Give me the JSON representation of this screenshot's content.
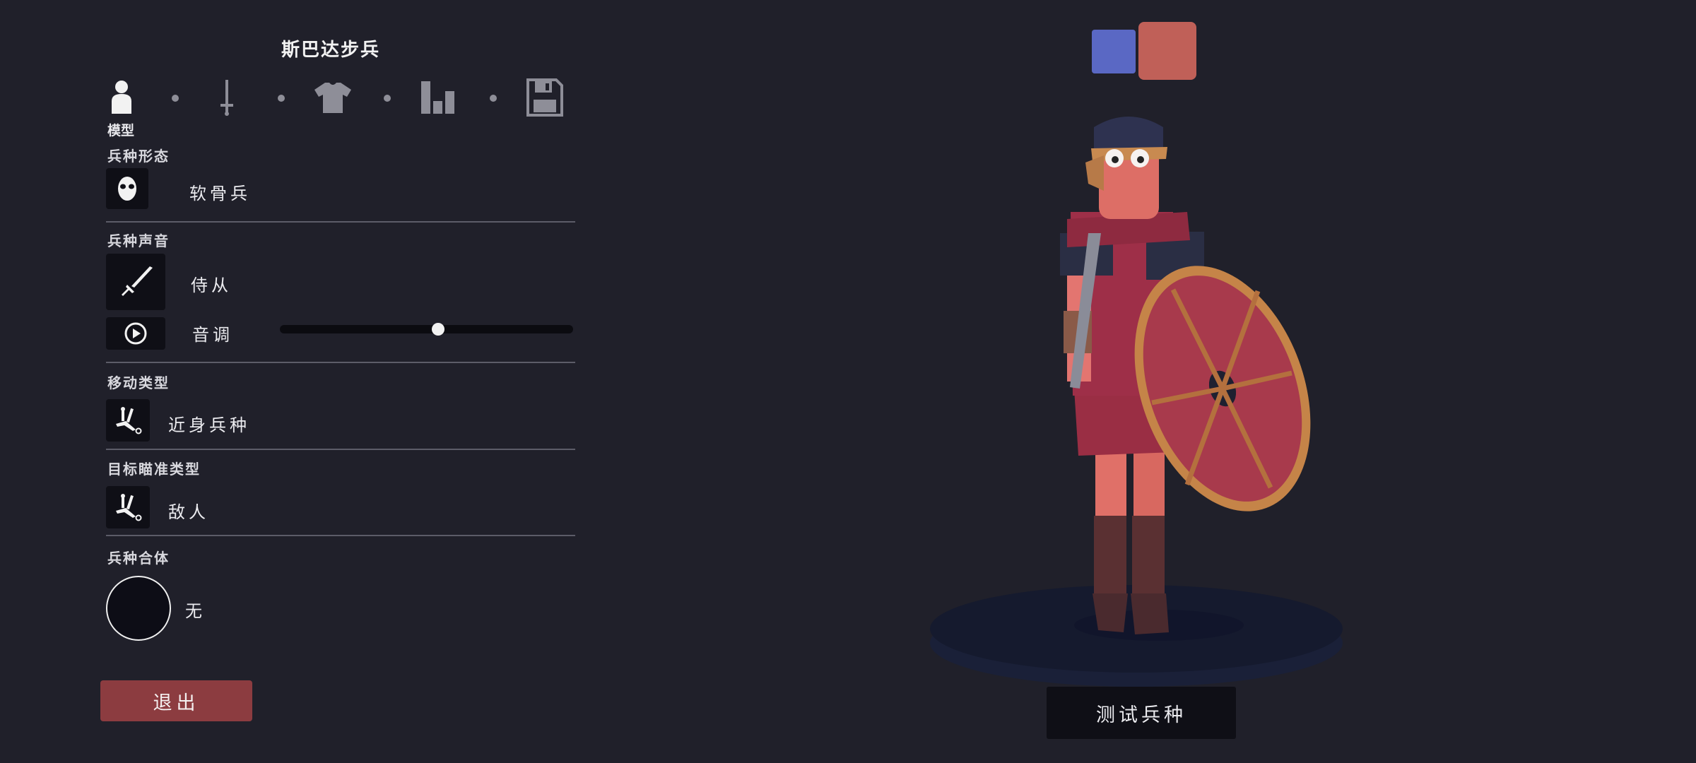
{
  "unit_name": "斯巴达步兵",
  "tabs": [
    {
      "label": "模型",
      "icon": "person-icon",
      "active": true
    },
    {
      "icon": "sword-icon"
    },
    {
      "icon": "shirt-icon"
    },
    {
      "icon": "bar-chart-icon"
    },
    {
      "icon": "save-icon"
    }
  ],
  "sections": {
    "form": {
      "label": "兵种形态",
      "value": "软骨兵",
      "icon": "mask-icon"
    },
    "voice": {
      "label": "兵种声音",
      "value": "侍从",
      "icon": "sword-icon",
      "pitch_label": "音调",
      "pitch_value": 0.54,
      "play_icon": "play-icon"
    },
    "movement": {
      "label": "移动类型",
      "value": "近身兵种",
      "icon": "melee-icon"
    },
    "targeting": {
      "label": "目标瞄准类型",
      "value": "敌人",
      "icon": "melee-icon"
    },
    "combine": {
      "label": "兵种合体",
      "value": "无"
    }
  },
  "buttons": {
    "exit": "退出",
    "test": "测试兵种"
  },
  "team_colors": {
    "blue": "#5a68c4",
    "red": "#c06058",
    "selected": "red"
  },
  "colors": {
    "background": "#20202a",
    "exit": "#8c3c40",
    "panel": "#0f0f16"
  }
}
